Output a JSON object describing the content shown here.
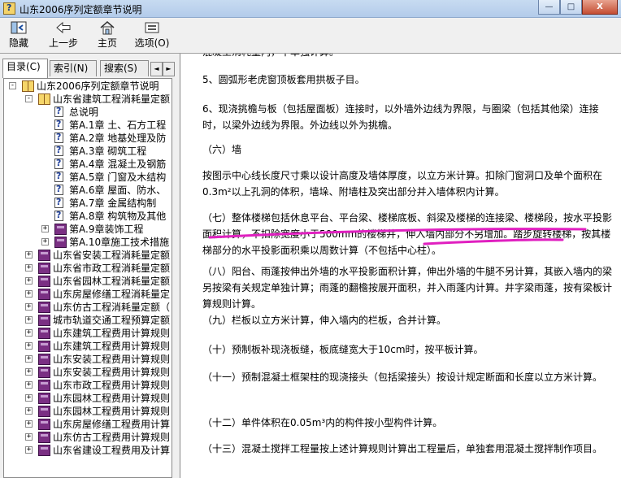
{
  "window": {
    "title": "山东2006序列定额章节说明",
    "minimize": "—",
    "maximize": "□",
    "close": "X"
  },
  "toolbar": {
    "hide": "隐藏",
    "back": "上一步",
    "home": "主页",
    "options": "选项(O)"
  },
  "tabs": {
    "contents": "目录(C)",
    "index": "索引(N)",
    "search": "搜索(S)",
    "left_arrow": "◄",
    "right_arrow": "►"
  },
  "tree": [
    {
      "label": "山东2006序列定额章节说明",
      "level": 0,
      "icon": "book-open",
      "expander": "-"
    },
    {
      "label": "山东省建筑工程消耗量定额",
      "level": 1,
      "icon": "book-open",
      "expander": "-"
    },
    {
      "label": "总说明",
      "level": 2,
      "icon": "page",
      "expander": ""
    },
    {
      "label": "第A.1章  土、石方工程",
      "level": 2,
      "icon": "page",
      "expander": ""
    },
    {
      "label": "第A.2章  地基处理及防",
      "level": 2,
      "icon": "page",
      "expander": ""
    },
    {
      "label": "第A.3章  砌筑工程",
      "level": 2,
      "icon": "page",
      "expander": ""
    },
    {
      "label": "第A.4章  混凝土及钢筋",
      "level": 2,
      "icon": "page",
      "expander": ""
    },
    {
      "label": "第A.5章  门窗及木结构",
      "level": 2,
      "icon": "page",
      "expander": ""
    },
    {
      "label": "第A.6章  屋面、防水、",
      "level": 2,
      "icon": "page",
      "expander": ""
    },
    {
      "label": "第A.7章  金属结构制",
      "level": 2,
      "icon": "page",
      "expander": ""
    },
    {
      "label": "第A.8章  构筑物及其他",
      "level": 2,
      "icon": "page",
      "expander": ""
    },
    {
      "label": "第A.9章装饰工程",
      "level": 2,
      "icon": "book-closed",
      "expander": "+"
    },
    {
      "label": "第A.10章施工技术措施",
      "level": 2,
      "icon": "book-closed",
      "expander": "+"
    },
    {
      "label": "山东省安装工程消耗量定额",
      "level": 1,
      "icon": "book-closed",
      "expander": "+"
    },
    {
      "label": "山东省市政工程消耗量定额",
      "level": 1,
      "icon": "book-closed",
      "expander": "+"
    },
    {
      "label": "山东省园林工程消耗量定额",
      "level": 1,
      "icon": "book-closed",
      "expander": "+"
    },
    {
      "label": "山东房屋修缮工程消耗量定",
      "level": 1,
      "icon": "book-closed",
      "expander": "+"
    },
    {
      "label": "山东仿古工程消耗量定额（",
      "level": 1,
      "icon": "book-closed",
      "expander": "+"
    },
    {
      "label": "城市轨道交通工程预算定额",
      "level": 1,
      "icon": "book-closed",
      "expander": "+"
    },
    {
      "label": "山东建筑工程费用计算规则",
      "level": 1,
      "icon": "book-closed",
      "expander": "+"
    },
    {
      "label": "山东建筑工程费用计算规则",
      "level": 1,
      "icon": "book-closed",
      "expander": "+"
    },
    {
      "label": "山东安装工程费用计算规则",
      "level": 1,
      "icon": "book-closed",
      "expander": "+"
    },
    {
      "label": "山东安装工程费用计算规则",
      "level": 1,
      "icon": "book-closed",
      "expander": "+"
    },
    {
      "label": "山东市政工程费用计算规则",
      "level": 1,
      "icon": "book-closed",
      "expander": "+"
    },
    {
      "label": "山东园林工程费用计算规则",
      "level": 1,
      "icon": "book-closed",
      "expander": "+"
    },
    {
      "label": "山东园林工程费用计算规则",
      "level": 1,
      "icon": "book-closed",
      "expander": "+"
    },
    {
      "label": "山东房屋修缮工程费用计算",
      "level": 1,
      "icon": "book-closed",
      "expander": "+"
    },
    {
      "label": "山东仿古工程费用计算规则",
      "level": 1,
      "icon": "book-closed",
      "expander": "+"
    },
    {
      "label": "山东省建设工程费用及计算",
      "level": 1,
      "icon": "book-closed",
      "expander": "+"
    }
  ],
  "content": [
    "混凝土消耗量内，不单独计算。",
    "5、圆弧形老虎窗顶板套用拱板子目。",
    "6、现浇挑檐与板（包括屋面板）连接时，以外墙外边线为界限，与圈梁（包括其他梁）连接时，以梁外边线为界限。外边线以外为挑檐。",
    "（六）墙",
    "按图示中心线长度尺寸乘以设计高度及墙体厚度，以立方米计算。扣除门窗洞口及单个面积在0.3m²以上孔洞的体积，墙垛、附墙柱及突出部分并入墙体积内计算。",
    "（七）整体楼梯包括休息平台、平台梁、楼梯底板、斜梁及楼梯的连接梁、楼梯段，按水平投影面积计算，不扣除宽度小于500mm的楼梯井，伸入墙内部分不另增加。踏步旋转楼梯，按其楼梯部分的水平投影面积乘以周数计算（不包括中心柱）。",
    "（八）阳台、雨蓬按伸出外墙的水平投影面积计算，伸出外墙的牛腿不另计算，其嵌入墙内的梁另按梁有关规定单独计算；雨蓬的翻檐按展开面积，并入雨蓬内计算。井字梁雨蓬，按有梁板计算规则计算。",
    "（九）栏板以立方米计算，伸入墙内的栏板，合并计算。",
    "（十）预制板补现浇板缝，板底缝宽大于10cm时，按平板计算。",
    "（十一）预制混凝土框架柱的现浇接头（包括梁接头）按设计规定断面和长度以立方米计算。",
    "（十二）单件体积在0.05m³内的构件按小型构件计算。",
    "（十三）混凝土搅拌工程量按上述计算规则计算出工程量后，单独套用混凝土搅拌制作项目。"
  ],
  "colors": {
    "annotation": "#e020c0",
    "titlebar": "#c7dbf1"
  }
}
